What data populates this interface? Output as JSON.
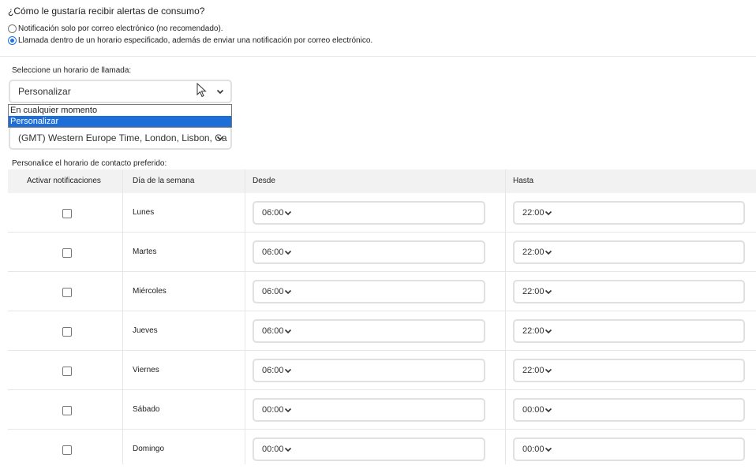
{
  "question": "¿Cómo le gustaría recibir alertas de consumo?",
  "options": [
    {
      "label": "Notificación solo por correo electrónico (no recomendado).",
      "checked": false
    },
    {
      "label": "Llamada dentro de un horario especificado, además de enviar una notificación por correo electrónico.",
      "checked": true
    }
  ],
  "schedule": {
    "label": "Seleccione un horario de llamada:",
    "selected": "Personalizar",
    "menu_options": [
      "En cualquier momento",
      "Personalizar"
    ],
    "highlighted_option": "Personalizar"
  },
  "timezone": {
    "selected": "(GMT) Western Europe Time, London, Lisbon, Ca"
  },
  "custom_label": "Personalice el horario de contacto preferido:",
  "table": {
    "headers": {
      "enable": "Activar notificaciones",
      "day": "Día de la semana",
      "from": "Desde",
      "to": "Hasta"
    },
    "rows": [
      {
        "day": "Lunes",
        "from": "06:00",
        "to": "22:00",
        "enabled": false
      },
      {
        "day": "Martes",
        "from": "06:00",
        "to": "22:00",
        "enabled": false
      },
      {
        "day": "Miércoles",
        "from": "06:00",
        "to": "22:00",
        "enabled": false
      },
      {
        "day": "Jueves",
        "from": "06:00",
        "to": "22:00",
        "enabled": false
      },
      {
        "day": "Viernes",
        "from": "06:00",
        "to": "22:00",
        "enabled": false
      },
      {
        "day": "Sábado",
        "from": "00:00",
        "to": "00:00",
        "enabled": false
      },
      {
        "day": "Domingo",
        "from": "00:00",
        "to": "00:00",
        "enabled": false
      }
    ]
  },
  "colors": {
    "accent": "#1a73e8",
    "highlight": "#1e6ed8",
    "header_bg": "#f2f2f2"
  }
}
